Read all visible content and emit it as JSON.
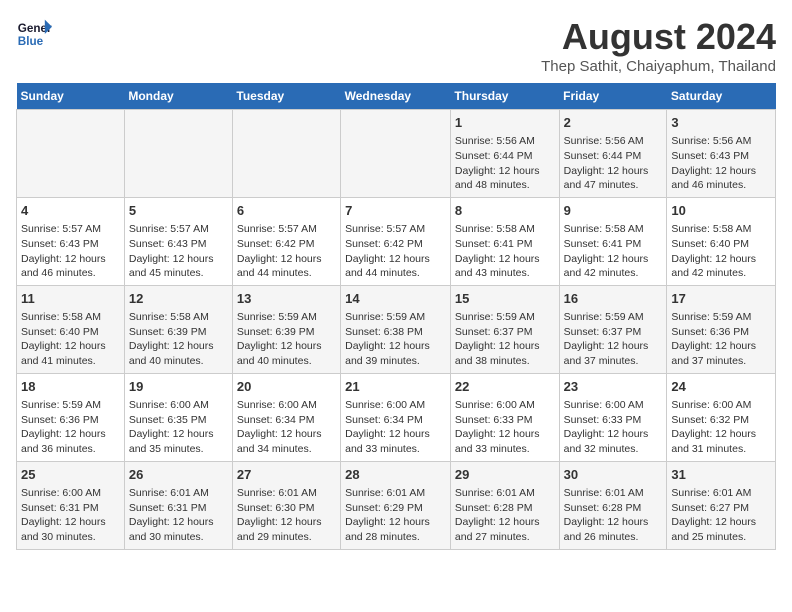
{
  "logo": {
    "line1": "General",
    "line2": "Blue"
  },
  "title": "August 2024",
  "subtitle": "Thep Sathit, Chaiyaphum, Thailand",
  "days_of_week": [
    "Sunday",
    "Monday",
    "Tuesday",
    "Wednesday",
    "Thursday",
    "Friday",
    "Saturday"
  ],
  "weeks": [
    [
      {
        "day": "",
        "info": ""
      },
      {
        "day": "",
        "info": ""
      },
      {
        "day": "",
        "info": ""
      },
      {
        "day": "",
        "info": ""
      },
      {
        "day": "1",
        "info": "Sunrise: 5:56 AM\nSunset: 6:44 PM\nDaylight: 12 hours and 48 minutes."
      },
      {
        "day": "2",
        "info": "Sunrise: 5:56 AM\nSunset: 6:44 PM\nDaylight: 12 hours and 47 minutes."
      },
      {
        "day": "3",
        "info": "Sunrise: 5:56 AM\nSunset: 6:43 PM\nDaylight: 12 hours and 46 minutes."
      }
    ],
    [
      {
        "day": "4",
        "info": "Sunrise: 5:57 AM\nSunset: 6:43 PM\nDaylight: 12 hours and 46 minutes."
      },
      {
        "day": "5",
        "info": "Sunrise: 5:57 AM\nSunset: 6:43 PM\nDaylight: 12 hours and 45 minutes."
      },
      {
        "day": "6",
        "info": "Sunrise: 5:57 AM\nSunset: 6:42 PM\nDaylight: 12 hours and 44 minutes."
      },
      {
        "day": "7",
        "info": "Sunrise: 5:57 AM\nSunset: 6:42 PM\nDaylight: 12 hours and 44 minutes."
      },
      {
        "day": "8",
        "info": "Sunrise: 5:58 AM\nSunset: 6:41 PM\nDaylight: 12 hours and 43 minutes."
      },
      {
        "day": "9",
        "info": "Sunrise: 5:58 AM\nSunset: 6:41 PM\nDaylight: 12 hours and 42 minutes."
      },
      {
        "day": "10",
        "info": "Sunrise: 5:58 AM\nSunset: 6:40 PM\nDaylight: 12 hours and 42 minutes."
      }
    ],
    [
      {
        "day": "11",
        "info": "Sunrise: 5:58 AM\nSunset: 6:40 PM\nDaylight: 12 hours and 41 minutes."
      },
      {
        "day": "12",
        "info": "Sunrise: 5:58 AM\nSunset: 6:39 PM\nDaylight: 12 hours and 40 minutes."
      },
      {
        "day": "13",
        "info": "Sunrise: 5:59 AM\nSunset: 6:39 PM\nDaylight: 12 hours and 40 minutes."
      },
      {
        "day": "14",
        "info": "Sunrise: 5:59 AM\nSunset: 6:38 PM\nDaylight: 12 hours and 39 minutes."
      },
      {
        "day": "15",
        "info": "Sunrise: 5:59 AM\nSunset: 6:37 PM\nDaylight: 12 hours and 38 minutes."
      },
      {
        "day": "16",
        "info": "Sunrise: 5:59 AM\nSunset: 6:37 PM\nDaylight: 12 hours and 37 minutes."
      },
      {
        "day": "17",
        "info": "Sunrise: 5:59 AM\nSunset: 6:36 PM\nDaylight: 12 hours and 37 minutes."
      }
    ],
    [
      {
        "day": "18",
        "info": "Sunrise: 5:59 AM\nSunset: 6:36 PM\nDaylight: 12 hours and 36 minutes."
      },
      {
        "day": "19",
        "info": "Sunrise: 6:00 AM\nSunset: 6:35 PM\nDaylight: 12 hours and 35 minutes."
      },
      {
        "day": "20",
        "info": "Sunrise: 6:00 AM\nSunset: 6:34 PM\nDaylight: 12 hours and 34 minutes."
      },
      {
        "day": "21",
        "info": "Sunrise: 6:00 AM\nSunset: 6:34 PM\nDaylight: 12 hours and 33 minutes."
      },
      {
        "day": "22",
        "info": "Sunrise: 6:00 AM\nSunset: 6:33 PM\nDaylight: 12 hours and 33 minutes."
      },
      {
        "day": "23",
        "info": "Sunrise: 6:00 AM\nSunset: 6:33 PM\nDaylight: 12 hours and 32 minutes."
      },
      {
        "day": "24",
        "info": "Sunrise: 6:00 AM\nSunset: 6:32 PM\nDaylight: 12 hours and 31 minutes."
      }
    ],
    [
      {
        "day": "25",
        "info": "Sunrise: 6:00 AM\nSunset: 6:31 PM\nDaylight: 12 hours and 30 minutes."
      },
      {
        "day": "26",
        "info": "Sunrise: 6:01 AM\nSunset: 6:31 PM\nDaylight: 12 hours and 30 minutes."
      },
      {
        "day": "27",
        "info": "Sunrise: 6:01 AM\nSunset: 6:30 PM\nDaylight: 12 hours and 29 minutes."
      },
      {
        "day": "28",
        "info": "Sunrise: 6:01 AM\nSunset: 6:29 PM\nDaylight: 12 hours and 28 minutes."
      },
      {
        "day": "29",
        "info": "Sunrise: 6:01 AM\nSunset: 6:28 PM\nDaylight: 12 hours and 27 minutes."
      },
      {
        "day": "30",
        "info": "Sunrise: 6:01 AM\nSunset: 6:28 PM\nDaylight: 12 hours and 26 minutes."
      },
      {
        "day": "31",
        "info": "Sunrise: 6:01 AM\nSunset: 6:27 PM\nDaylight: 12 hours and 25 minutes."
      }
    ]
  ]
}
